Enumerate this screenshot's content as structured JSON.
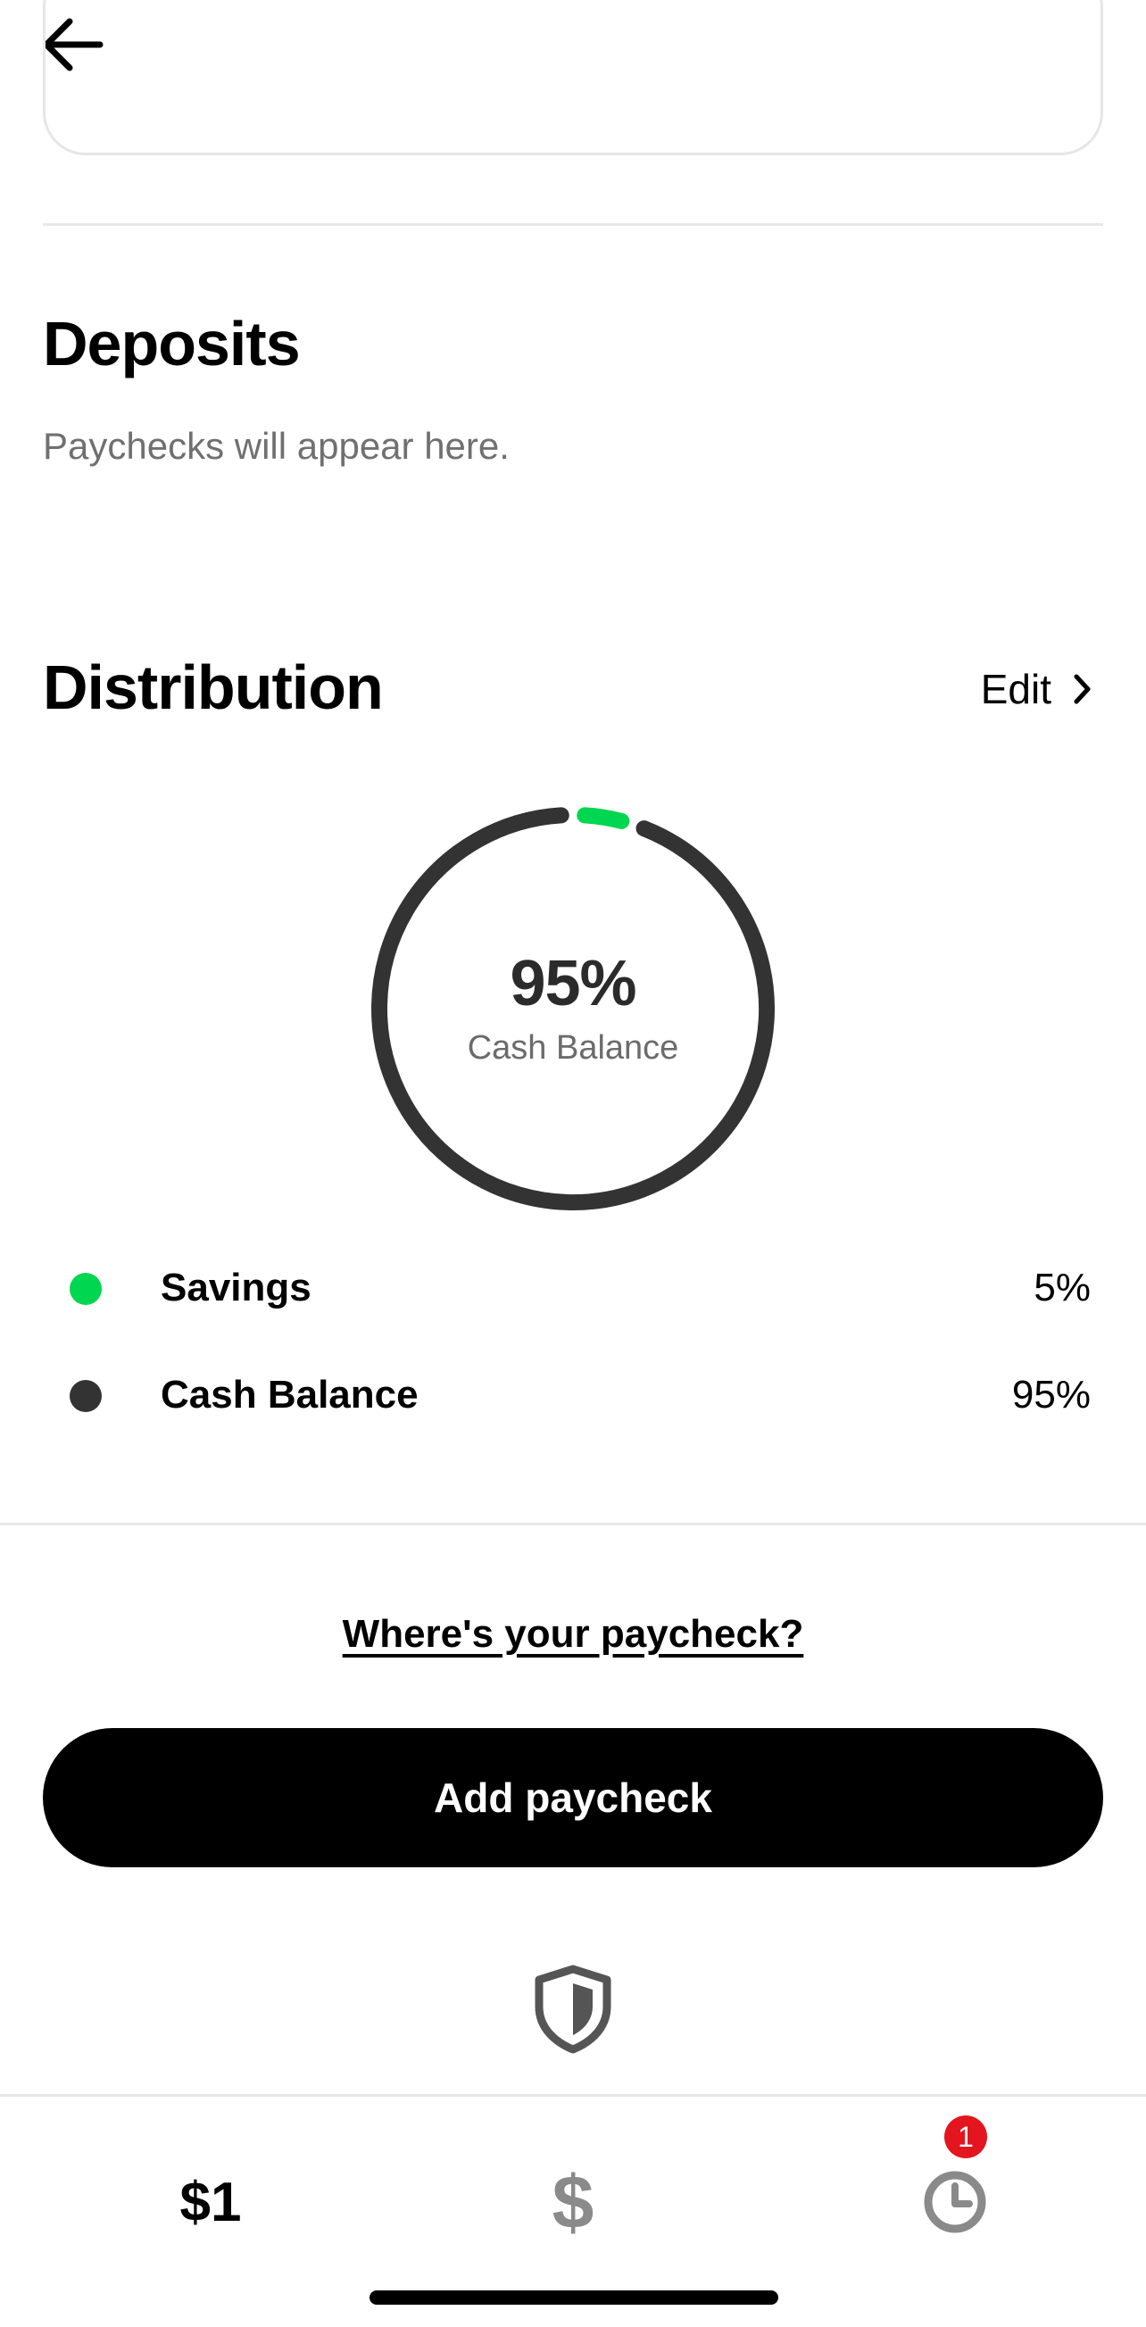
{
  "header": {
    "back_icon": "arrow-left-icon"
  },
  "deposits": {
    "title": "Deposits",
    "empty_text": "Paychecks will appear here."
  },
  "distribution": {
    "title": "Distribution",
    "edit_label": "Edit",
    "edit_icon": "chevron-right-icon",
    "center_value": "95%",
    "center_label": "Cash Balance",
    "items": [
      {
        "name": "Savings",
        "value": "5%",
        "color": "#00d64f",
        "percent": 5
      },
      {
        "name": "Cash Balance",
        "value": "95%",
        "color": "#333333",
        "percent": 95
      }
    ]
  },
  "actions": {
    "where_link": "Where's your paycheck?",
    "add_button": "Add paycheck",
    "security_icon": "shield-icon"
  },
  "tabbar": {
    "balance_label": "$1",
    "money_glyph": "$",
    "activity_icon": "clock-icon",
    "activity_badge": "1"
  },
  "colors": {
    "accent_green": "#00d64f",
    "ring_dark": "#333333",
    "badge_red": "#e3151f"
  }
}
